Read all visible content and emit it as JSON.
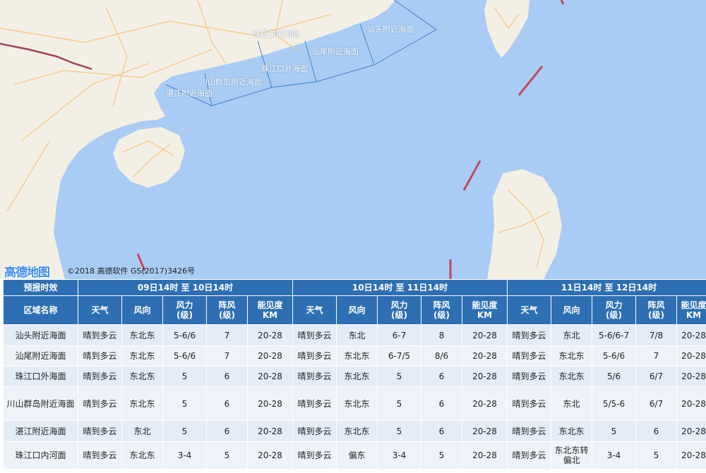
{
  "map": {
    "region_labels": [
      "珠江口内河面",
      "汕头附近海面",
      "汕尾附近海面",
      "珠江口外海面",
      "川山群岛附近海面",
      "湛江附近海面"
    ],
    "logo": "高德地图",
    "copyright": "©2018 高德软件 GS(2017)3426号",
    "colors": {
      "sea": "#a9ccf4",
      "land": "#f4efe4",
      "road": "#f3c98d",
      "border": "#a0455a"
    }
  },
  "table": {
    "header": {
      "period_label": "预报时效",
      "periods": [
        "09日14时 至 10日14时",
        "10日14时 至 11日14时",
        "11日14时 至 12日14时"
      ],
      "region_label": "区域名称",
      "columns": [
        {
          "line1": "天气",
          "line2": ""
        },
        {
          "line1": "风向",
          "line2": ""
        },
        {
          "line1": "风力",
          "line2": "(级)"
        },
        {
          "line1": "阵风",
          "line2": "(级)"
        },
        {
          "line1": "能见度",
          "line2": "KM"
        }
      ]
    },
    "rows": [
      {
        "name": "汕头附近海面",
        "cells": [
          "晴到多云",
          "东北东",
          "5-6/6",
          "7",
          "20-28",
          "晴到多云",
          "东北",
          "6-7",
          "8",
          "20-28",
          "晴到多云",
          "东北",
          "5-6/6-7",
          "7/8",
          "20-28"
        ]
      },
      {
        "name": "汕尾附近海面",
        "cells": [
          "晴到多云",
          "东北东",
          "5-6/6",
          "7",
          "20-28",
          "晴到多云",
          "东北东",
          "6-7/5",
          "8/6",
          "20-28",
          "晴到多云",
          "东北东",
          "5-6/6",
          "7",
          "20-28"
        ]
      },
      {
        "name": "珠江口外海面",
        "cells": [
          "晴到多云",
          "东北东",
          "5",
          "6",
          "20-28",
          "晴到多云",
          "东北东",
          "5",
          "6",
          "20-28",
          "晴到多云",
          "东北东",
          "5/6",
          "6/7",
          "20-28"
        ]
      },
      {
        "name": "川山群岛附近海面",
        "cells": [
          "晴到多云",
          "东北东",
          "5",
          "6",
          "20-28",
          "晴到多云",
          "东北东",
          "5",
          "6",
          "20-28",
          "晴到多云",
          "东北",
          "5/5-6",
          "6/7",
          "20-28"
        ]
      },
      {
        "name": "湛江附近海面",
        "cells": [
          "晴到多云",
          "东北",
          "5",
          "6",
          "20-28",
          "晴到多云",
          "东北东",
          "5",
          "6",
          "20-28",
          "晴到多云",
          "东北东",
          "5",
          "6",
          "20-28"
        ]
      },
      {
        "name": "珠江口内河面",
        "cells": [
          "晴到多云",
          "东北东",
          "3-4",
          "5",
          "20-28",
          "晴到多云",
          "偏东",
          "3-4",
          "5",
          "20-28",
          "晴到多云",
          "东北东转偏北",
          "3-4",
          "5",
          "20-28"
        ]
      }
    ]
  }
}
